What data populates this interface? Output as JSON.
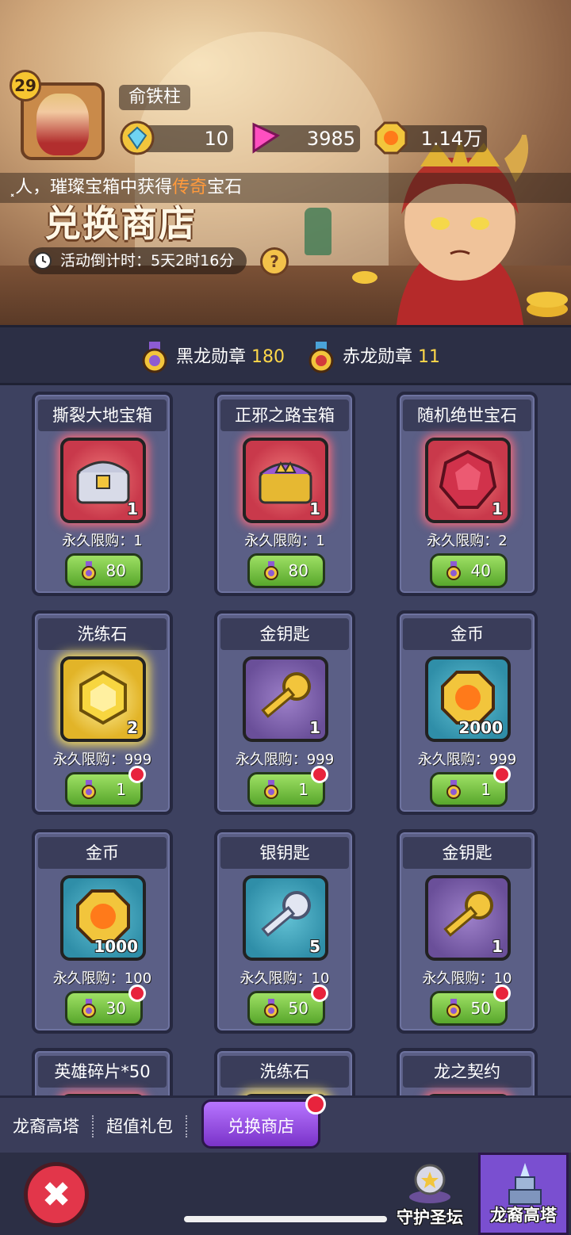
{
  "player": {
    "level": "29",
    "name": "俞铁柱"
  },
  "currencies": [
    {
      "icon": "diamond-coin-icon",
      "value": "10"
    },
    {
      "icon": "pink-gem-icon",
      "value": "3985"
    },
    {
      "icon": "gold-coin-icon",
      "value": "1.14万"
    }
  ],
  "ticker": {
    "prefix": "⸼人，璀璨宝箱中获得",
    "highlight": "传奇",
    "suffix": "宝石"
  },
  "shop": {
    "title": "兑换商店",
    "countdown": "活动倒计时：5天2时16分",
    "help": "?"
  },
  "medals": [
    {
      "label": "黑龙勋章",
      "count": "180",
      "color": "#8d5bd3"
    },
    {
      "label": "赤龙勋章",
      "count": "11",
      "color": "#d33b3b"
    }
  ],
  "items": [
    {
      "title": "撕裂大地宝箱",
      "icon": "silver-chest-icon",
      "style": "red",
      "qty": "1",
      "limit": "永久限购：1",
      "price": "80",
      "dot": false
    },
    {
      "title": "正邪之路宝箱",
      "icon": "gold-chest-icon",
      "style": "red",
      "qty": "1",
      "limit": "永久限购：1",
      "price": "80",
      "dot": false
    },
    {
      "title": "随机绝世宝石",
      "icon": "ruby-gem-icon",
      "style": "red",
      "qty": "1",
      "limit": "永久限购：2",
      "price": "40",
      "dot": false
    },
    {
      "title": "洗练石",
      "icon": "yellow-stone-icon",
      "style": "gold",
      "qty": "2",
      "limit": "永久限购：999",
      "price": "1",
      "dot": true
    },
    {
      "title": "金钥匙",
      "icon": "gold-key-icon",
      "style": "purple",
      "qty": "1",
      "limit": "永久限购：999",
      "price": "1",
      "dot": true
    },
    {
      "title": "金币",
      "icon": "gold-coin-icon",
      "style": "teal",
      "qty": "2000",
      "limit": "永久限购：999",
      "price": "1",
      "dot": true
    },
    {
      "title": "金币",
      "icon": "gold-coin-icon",
      "style": "teal",
      "qty": "1000",
      "limit": "永久限购：100",
      "price": "30",
      "dot": true
    },
    {
      "title": "银钥匙",
      "icon": "silver-key-icon",
      "style": "teal",
      "qty": "5",
      "limit": "永久限购：10",
      "price": "50",
      "dot": true
    },
    {
      "title": "金钥匙",
      "icon": "gold-key-icon",
      "style": "purple",
      "qty": "1",
      "limit": "永久限购：10",
      "price": "50",
      "dot": true
    },
    {
      "title": "英雄碎片*50",
      "icon": "hero-shard-icon",
      "style": "red",
      "qty": "",
      "limit": "",
      "price": "",
      "dot": false
    },
    {
      "title": "洗练石",
      "icon": "yellow-stone-icon",
      "style": "gold",
      "qty": "",
      "limit": "",
      "price": "",
      "dot": false
    },
    {
      "title": "龙之契约",
      "icon": "dragon-contract-icon",
      "style": "red",
      "qty": "",
      "limit": "",
      "price": "",
      "dot": false
    }
  ],
  "tabs": [
    {
      "label": "龙裔高塔"
    },
    {
      "label": "超值礼包"
    },
    {
      "label": "兑换商店",
      "active": true
    }
  ],
  "nav": [
    {
      "label": "守护圣坛",
      "icon": "altar-icon"
    },
    {
      "label": "龙裔高塔",
      "icon": "tower-icon",
      "selected": true
    }
  ],
  "close_label": "✖"
}
